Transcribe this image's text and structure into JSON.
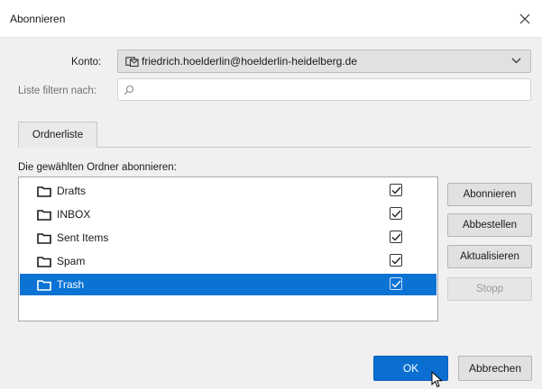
{
  "window": {
    "title": "Abonnieren"
  },
  "account": {
    "label": "Konto:",
    "value": "friedrich.hoelderlin@hoelderlin-heidelberg.de"
  },
  "filter": {
    "label": "Liste filtern nach:",
    "value": "",
    "placeholder": ""
  },
  "tabs": [
    {
      "label": "Ordnerliste",
      "active": true
    }
  ],
  "list": {
    "caption": "Die gewählten Ordner abonnieren:",
    "folders": [
      {
        "name": "Drafts",
        "subscribed": true,
        "selected": false
      },
      {
        "name": "INBOX",
        "subscribed": true,
        "selected": false
      },
      {
        "name": "Sent Items",
        "subscribed": true,
        "selected": false
      },
      {
        "name": "Spam",
        "subscribed": true,
        "selected": false
      },
      {
        "name": "Trash",
        "subscribed": true,
        "selected": true
      }
    ]
  },
  "buttons": {
    "subscribe": "Abonnieren",
    "unsubscribe": "Abbestellen",
    "refresh": "Aktualisieren",
    "stop": "Stopp",
    "ok": "OK",
    "cancel": "Abbrechen"
  },
  "colors": {
    "accent": "#0a73d4",
    "dialog_bg": "#f0f0f0"
  }
}
